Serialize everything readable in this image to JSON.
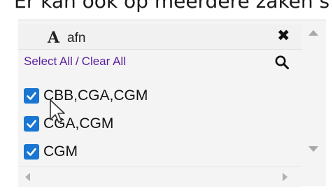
{
  "page": {
    "partial_text": "Er kan ook op meerdere zaken s"
  },
  "filter": {
    "type_icon": "A",
    "field_name": "afn",
    "close_icon": "close-icon",
    "search_icon": "search-icon",
    "select_all": "Select All",
    "separator": "/",
    "clear_all": "Clear All",
    "checkbox_color": "#1976d2",
    "link_color": "#5a1f9e",
    "items": [
      {
        "label": "CBB,CGA,CGM",
        "checked": true
      },
      {
        "label": "CGA,CGM",
        "checked": true
      },
      {
        "label": "CGM",
        "checked": true
      }
    ]
  }
}
